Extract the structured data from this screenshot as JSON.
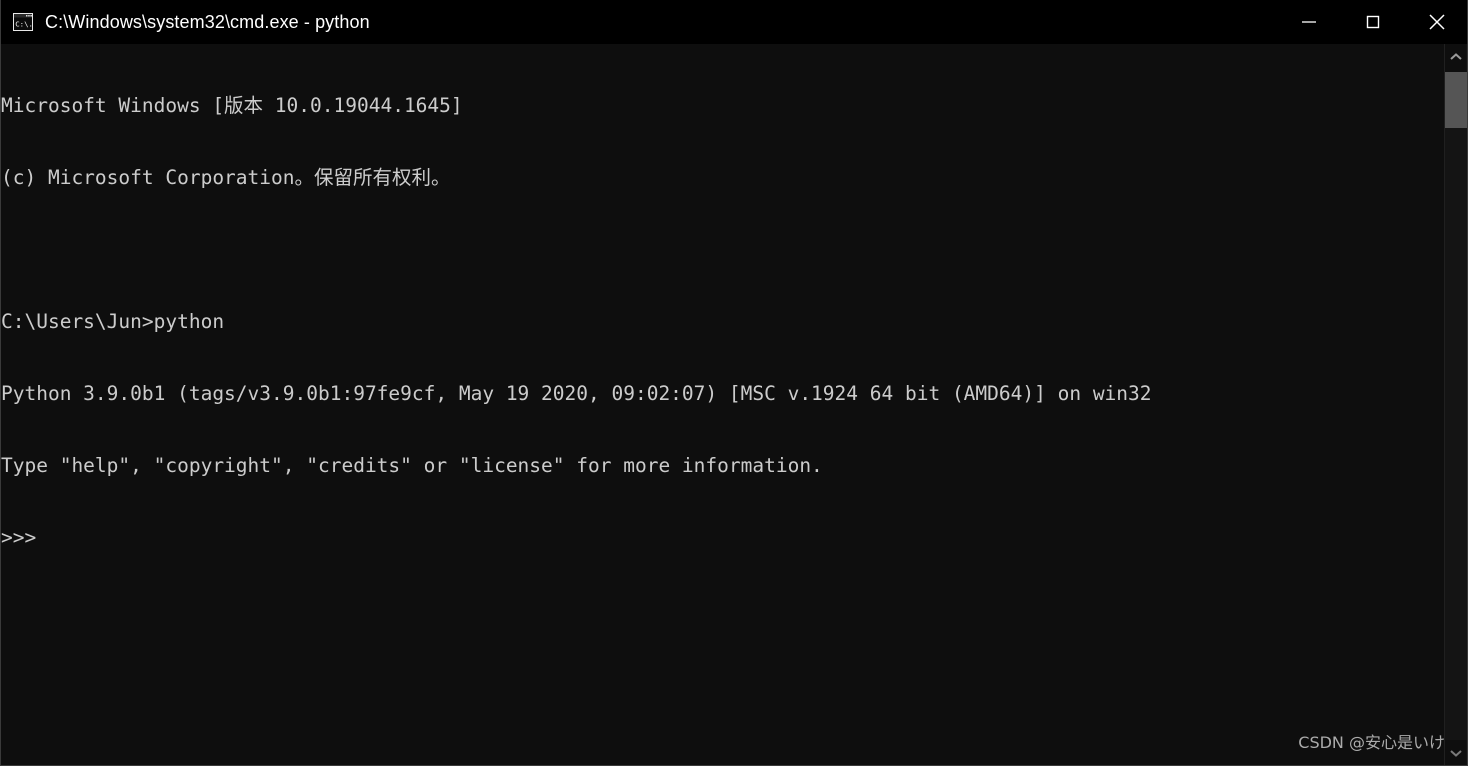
{
  "window": {
    "title": "C:\\Windows\\system32\\cmd.exe - python",
    "icon": "cmd-console-icon",
    "colors": {
      "titlebar_background": "#000000",
      "console_background": "#0e0e0e",
      "console_text": "#cccccc",
      "title_text": "#ffffff",
      "scrollbar_thumb": "#555555",
      "window_border": "#3a3a3a"
    },
    "controls": [
      {
        "name": "minimize",
        "label": "Minimize",
        "glyph": "minimize-icon"
      },
      {
        "name": "maximize",
        "label": "Maximize",
        "glyph": "maximize-icon"
      },
      {
        "name": "close",
        "label": "Close",
        "glyph": "close-icon"
      }
    ]
  },
  "console": {
    "lines": [
      "Microsoft Windows [版本 10.0.19044.1645]",
      "(c) Microsoft Corporation。保留所有权利。",
      "",
      "C:\\Users\\Jun>python",
      "Python 3.9.0b1 (tags/v3.9.0b1:97fe9cf, May 19 2020, 09:02:07) [MSC v.1924 64 bit (AMD64)] on win32",
      "Type \"help\", \"copyright\", \"credits\" or \"license\" for more information.",
      ">>>"
    ],
    "prompt": ">>>",
    "shell_prompt": "C:\\Users\\Jun>",
    "command_entered": "python"
  },
  "scrollbar": {
    "up_arrow": "chevron-up-icon",
    "down_arrow": "chevron-down-icon",
    "thumb_position_percent": 0
  },
  "watermark": {
    "text": "CSDN @安心是いけ"
  }
}
